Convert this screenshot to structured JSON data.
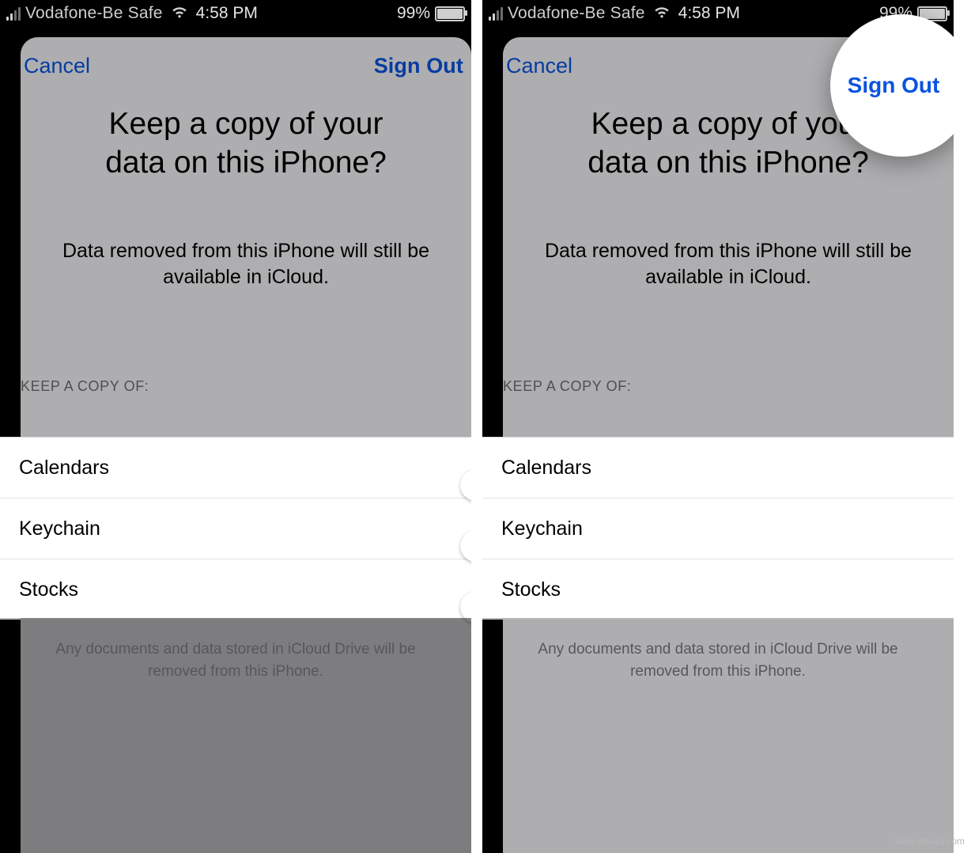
{
  "status": {
    "carrier": "Vodafone-Be Safe",
    "time": "4:58 PM",
    "battery_pct": "99%"
  },
  "sheet": {
    "cancel": "Cancel",
    "signout": "Sign Out",
    "title_l1": "Keep a copy of your",
    "title_l2": "data on this iPhone?",
    "subtitle_l1": "Data removed from this iPhone will still be",
    "subtitle_l2": "available in iCloud.",
    "section_header": "KEEP A COPY OF:",
    "footer_l1": "Any documents and data stored in iCloud Drive will be",
    "footer_l2": "removed from this iPhone."
  },
  "items": [
    {
      "label": "Calendars"
    },
    {
      "label": "Keychain"
    },
    {
      "label": "Stocks"
    }
  ],
  "left_toggles": [
    false,
    false,
    false
  ],
  "right_toggles": [
    true,
    true,
    true
  ],
  "watermark": "www.deuaq.com"
}
